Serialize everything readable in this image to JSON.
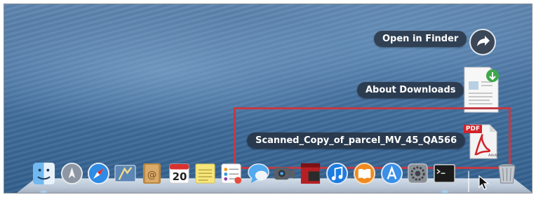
{
  "stack_menu": {
    "open_in_finder": "Open in Finder",
    "about_downloads": "About Downloads",
    "file_item": "Scanned_Copy_of_parcel_MV_45_QA566",
    "pdf_badge": "PDF"
  },
  "dock": {
    "calendar_day": "20",
    "apps": [
      "finder-icon",
      "launchpad-icon",
      "safari-icon",
      "mail-icon",
      "contacts-icon",
      "calendar-icon",
      "notes-icon",
      "reminders-icon",
      "messages-icon",
      "facetime-icon",
      "photo-booth-icon",
      "itunes-icon",
      "ibooks-icon",
      "app-store-icon",
      "system-preferences-icon",
      "terminal-icon"
    ]
  },
  "colors": {
    "highlight": "#c23a44",
    "label_bg": "#26303e",
    "wallpaper": "#4a74a2"
  }
}
